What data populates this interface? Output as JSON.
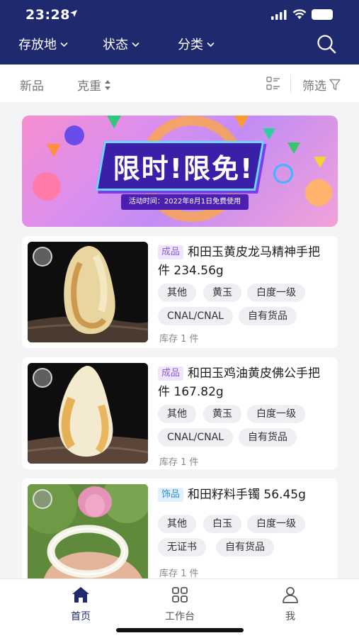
{
  "status_bar": {
    "time": "23:28"
  },
  "filters": [
    {
      "label": "存放地"
    },
    {
      "label": "状态"
    },
    {
      "label": "分类"
    }
  ],
  "sort_bar": {
    "new_label": "新品",
    "weight_label": "克重",
    "filter_label": "筛选"
  },
  "banner": {
    "title": "限时!限免!",
    "subtitle": "活动时间：2022年8月1日免费使用"
  },
  "products": [
    {
      "badge": "成品",
      "title": "和田玉黄皮龙马精神手把件 234.56g",
      "tags": [
        "其他",
        "黄玉",
        "白度一级",
        "CNAL/CNAL",
        "自有货品"
      ],
      "stock": "库存 1 件"
    },
    {
      "badge": "成品",
      "title": "和田玉鸡油黄皮佛公手把件 167.82g",
      "tags": [
        "其他",
        "黄玉",
        "白度一级",
        "CNAL/CNAL",
        "自有货品"
      ],
      "stock": "库存 1 件"
    },
    {
      "badge": "饰品",
      "title": "和田籽料手镯 56.45g",
      "tags": [
        "其他",
        "白玉",
        "白度一级",
        "无证书",
        "自有货品"
      ],
      "stock": "库存 1 件"
    }
  ],
  "tab_bar": {
    "tabs": [
      {
        "label": "首页",
        "icon": "home-icon",
        "active": true
      },
      {
        "label": "工作台",
        "icon": "grid-icon",
        "active": false
      },
      {
        "label": "我",
        "icon": "person-icon",
        "active": false
      }
    ]
  },
  "colors": {
    "header_bg": "#1f2a6e",
    "active_tab": "#1f2a6e",
    "inactive_tab": "#666666",
    "badge_purple": "#8f5bd8",
    "badge_blue": "#2e8fd0"
  }
}
